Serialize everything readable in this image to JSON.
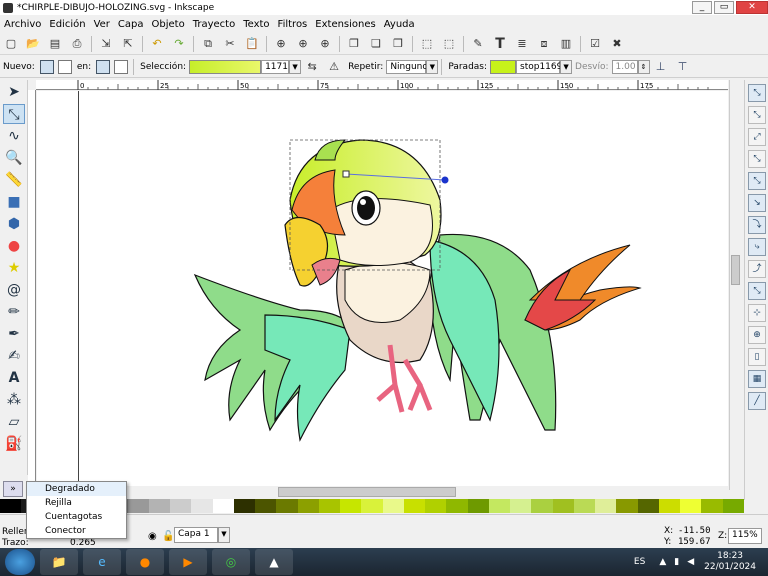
{
  "window": {
    "title": "*CHIRPLE-DIBUJO-HOLOZING.svg - Inkscape",
    "buttons": [
      "_",
      "▭",
      "✕"
    ]
  },
  "menu": [
    "Archivo",
    "Edición",
    "Ver",
    "Capa",
    "Objeto",
    "Trayecto",
    "Texto",
    "Filtros",
    "Extensiones",
    "Ayuda"
  ],
  "toolbar2": {
    "nuevo_label": "Nuevo:",
    "en_label": "en:",
    "seleccion_label": "Selección:",
    "seleccion_value": "1171",
    "repetir_label": "Repetir:",
    "repetir_value": "Ninguno",
    "paradas_label": "Paradas:",
    "paradas_value": "stop1169",
    "desvio_label": "Desvío:",
    "desvio_value": "1.00"
  },
  "ruler_ticks": [
    "0",
    "25",
    "50",
    "75",
    "100",
    "125",
    "150",
    "175"
  ],
  "popup": {
    "items": [
      "Degradado",
      "Rejilla",
      "Cuentagotas",
      "Conector"
    ],
    "highlighted": 0
  },
  "status": {
    "relleno_label": "Relleno:",
    "trazo_label": "Trazo:",
    "trazo_value": "0.265",
    "layer_label": "Capa 1",
    "x_label": "X:",
    "x_value": "-11.50",
    "y_label": "Y:",
    "y_value": "159.67",
    "z_label": "Z:",
    "zoom_value": "115%"
  },
  "taskbar": {
    "lang": "ES",
    "time": "18:23",
    "date": "22/01/2024"
  },
  "colors": {
    "gradient_start": "#c6ee2a",
    "stop": "#c7f21a"
  },
  "icons": {
    "left_tools": [
      "select-arrow-icon",
      "node-tool-icon",
      "tweak-icon",
      "zoom-icon",
      "measure-icon",
      "rect-icon",
      "box3d-icon",
      "ellipse-icon",
      "star-icon",
      "spiral-icon",
      "pencil-icon",
      "pen-icon",
      "calligraphy-icon",
      "text-icon",
      "spray-icon",
      "eraser-icon",
      "bucket-icon"
    ]
  }
}
